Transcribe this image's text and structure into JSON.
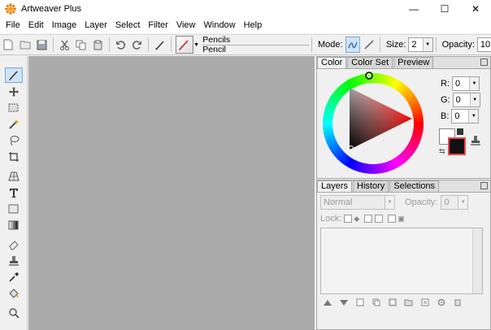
{
  "window": {
    "title": "Artweaver Plus",
    "controls": [
      "—",
      "☐",
      "✕"
    ]
  },
  "menu": [
    "File",
    "Edit",
    "Image",
    "Layer",
    "Select",
    "Filter",
    "View",
    "Window",
    "Help"
  ],
  "toolbar": {
    "brush_category": "Pencils",
    "brush_name": "Pencil",
    "mode_label": "Mode:",
    "size_label": "Size:",
    "size_value": "2",
    "opacity_label": "Opacity:",
    "opacity_value": "10"
  },
  "color_panel": {
    "tabs": [
      "Color",
      "Color Set",
      "Preview"
    ],
    "r_label": "R:",
    "g_label": "G:",
    "b_label": "B:",
    "r": "0",
    "g": "0",
    "b": "0",
    "foreground": "#111111",
    "background": "#ffffff"
  },
  "layers_panel": {
    "tabs": [
      "Layers",
      "History",
      "Selections"
    ],
    "blend_mode": "Normal",
    "opacity_label": "Opacity:",
    "opacity_value": "0",
    "lock_label": "Lock:"
  },
  "colors": {
    "canvas": "#ababab",
    "accent": "#7aa7d8"
  }
}
